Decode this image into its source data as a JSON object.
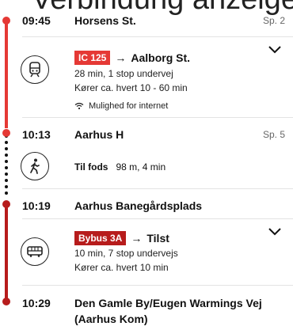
{
  "colors": {
    "accent": "#e53935",
    "dark_red": "#b71c1c",
    "dots": "#111111"
  },
  "header": {
    "cut_text": "Verbindung anzeigen"
  },
  "stops": [
    {
      "time": "09:45",
      "name": "Horsens St.",
      "track": "Sp. 2"
    },
    {
      "time": "10:13",
      "name": "Aarhus H",
      "track": "Sp. 5"
    },
    {
      "time": "10:19",
      "name": "Aarhus Banegårdsplads",
      "track": ""
    },
    {
      "time": "10:29",
      "name": "Den Gamle By/Eugen Warmings Vej",
      "name2": "(Aarhus Kom)",
      "track": ""
    }
  ],
  "legs": [
    {
      "badge": "IC 125",
      "arrow": "→",
      "dest": "Aalborg St.",
      "line1": "28 min, 1 stop undervej",
      "line2": "Kører ca. hvert 10 - 60 min",
      "wifi": "Mulighed for internet",
      "icon": "train-icon"
    },
    {
      "label": "Til fods",
      "detail": "98 m, 4 min",
      "icon": "walking-icon"
    },
    {
      "badge": "Bybus 3A",
      "arrow": "→",
      "dest": "Tilst",
      "line1": "10 min, 7 stop undervejs",
      "line2": "Kører ca. hvert 10 min",
      "icon": "bus-icon"
    }
  ]
}
